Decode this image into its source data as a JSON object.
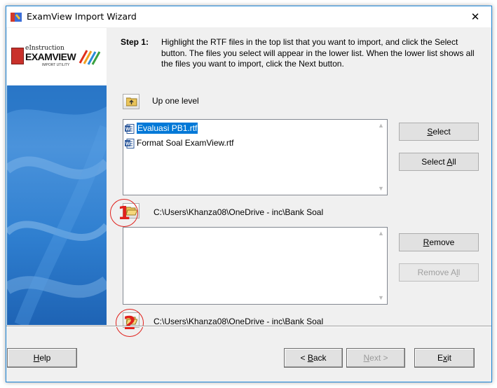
{
  "window": {
    "title": "ExamView Import Wizard",
    "close_glyph": "✕"
  },
  "banner": {
    "logo_small": "eInstruction",
    "logo_main": "EXAMVIEW",
    "logo_sub": "IMPORT UTILITY"
  },
  "step": {
    "label": "Step 1:",
    "text": "Highlight the RTF files in the top list that you want to import, and click the Select button.  The files you select will appear in the lower list.  When the lower list shows all the files you want to import, click the Next button."
  },
  "navigation": {
    "up_one_level": "Up one level"
  },
  "source_list": {
    "files": [
      {
        "name": "Evaluasi PB1.rtf",
        "selected": true,
        "icon": "word-doc-icon"
      },
      {
        "name": "Format Soal ExamView.rtf",
        "selected": false,
        "icon": "word-doc-icon"
      }
    ],
    "path": "C:\\Users\\Khanza08\\OneDrive - inc\\Bank Soal"
  },
  "target_list": {
    "files": [],
    "path": "C:\\Users\\Khanza08\\OneDrive - inc\\Bank Soal"
  },
  "buttons": {
    "select": {
      "before": "",
      "key": "S",
      "after": "elect"
    },
    "select_all": {
      "before": "Select ",
      "key": "A",
      "after": "ll"
    },
    "remove": {
      "before": "",
      "key": "R",
      "after": "emove"
    },
    "remove_all": {
      "before": "Remove A",
      "key": "l",
      "after": "l",
      "disabled": true
    }
  },
  "footer": {
    "help": {
      "before": "",
      "key": "H",
      "after": "elp"
    },
    "back": {
      "before": "< ",
      "key": "B",
      "after": "ack"
    },
    "next": {
      "before": "",
      "key": "N",
      "after": "ext >",
      "disabled": true
    },
    "exit": {
      "before": "E",
      "key": "x",
      "after": "it"
    }
  },
  "annotations": {
    "marker_1": "1",
    "marker_2": "2",
    "color": "#e0201b"
  },
  "colors": {
    "selection": "#0078d7",
    "window_border": "#1883d7",
    "banner_blue": "#2a78c8"
  }
}
